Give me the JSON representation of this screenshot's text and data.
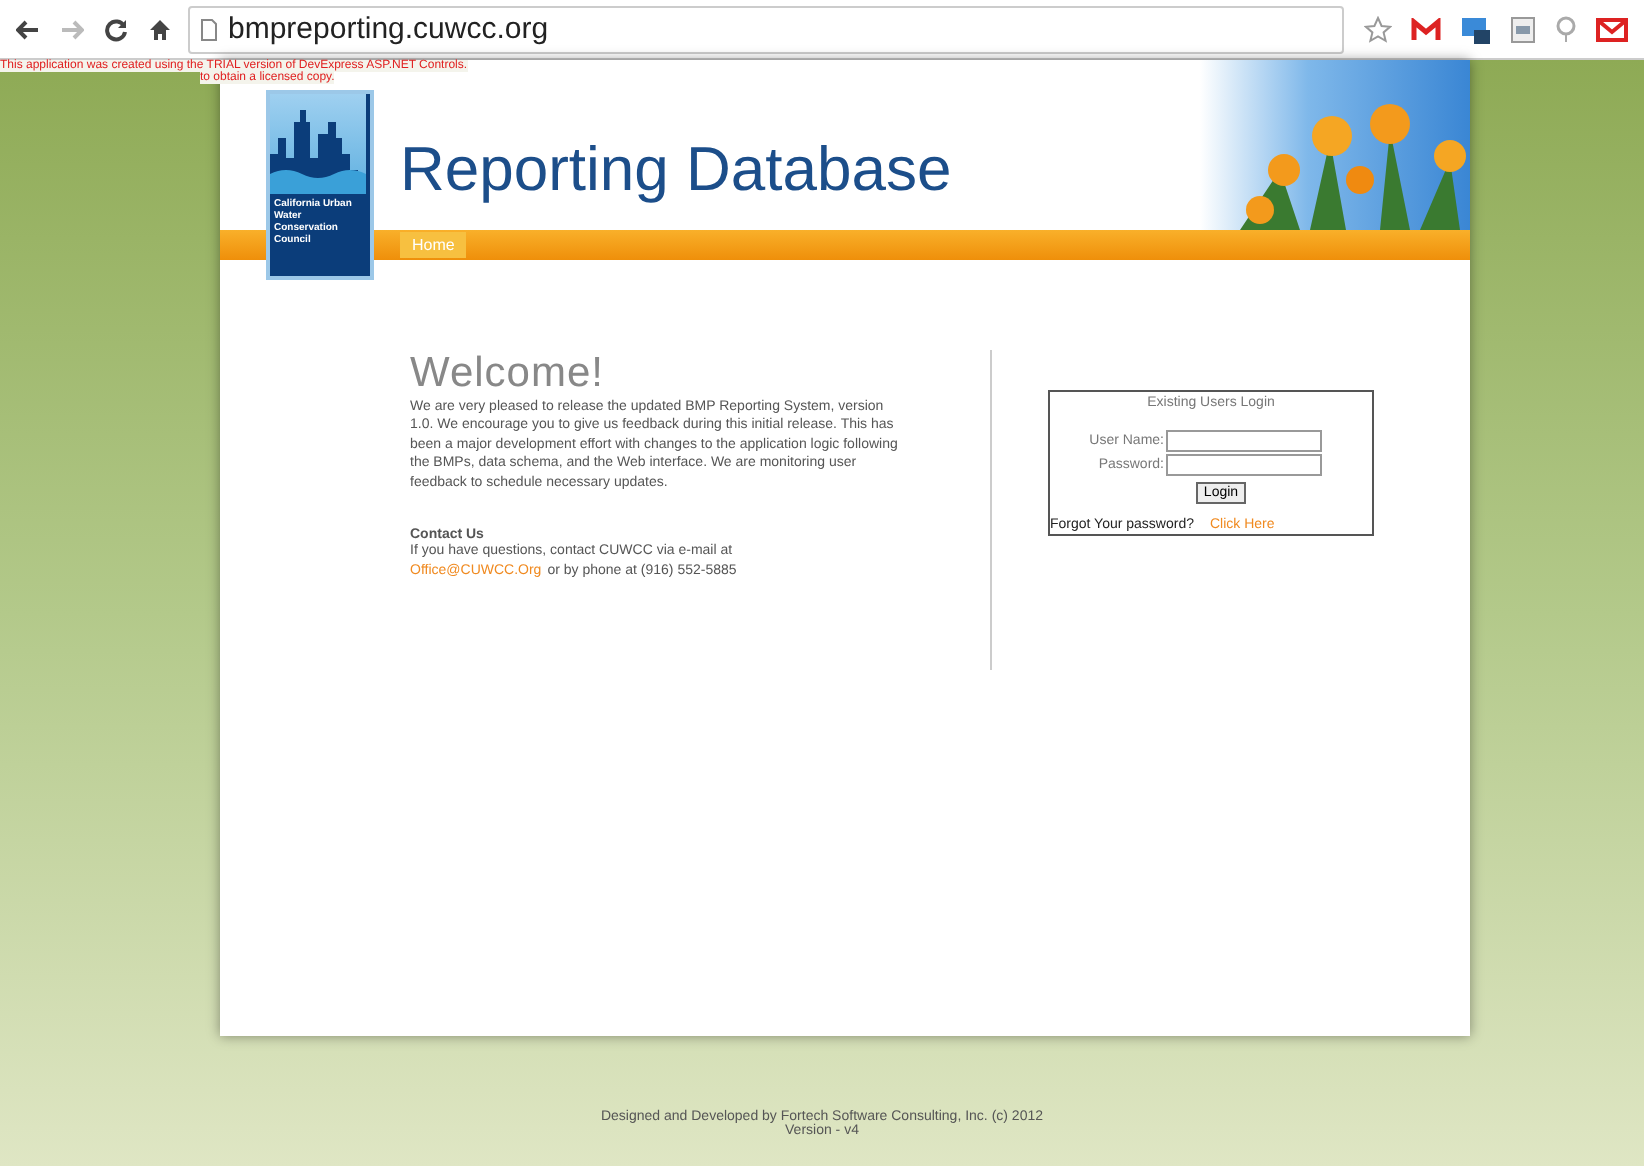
{
  "browser": {
    "url": "bmpreporting.cuwcc.org"
  },
  "trial_notice": {
    "line_1": "This application was created using the TRIAL version of DevExpress ASP.NET Controls.",
    "line_2": "to obtain a licensed copy."
  },
  "header": {
    "logo_text": "California Urban Water Conservation Council",
    "title": "Reporting Database"
  },
  "nav": [
    {
      "label": "Home",
      "selected": true
    }
  ],
  "welcome": {
    "heading": "Welcome!",
    "body": "We are very pleased to release the updated BMP Reporting System, version 1.0. We encourage you to give us feedback during this initial release. This has been a major development effort with changes to the application logic following the BMPs, data schema, and the Web interface. We are monitoring user feedback to schedule necessary updates.",
    "contact_heading": "Contact Us",
    "contact_line": "If you have questions, contact CUWCC via e-mail at",
    "contact_email": "Office@CUWCC.Org",
    "contact_phone": "or by phone at (916) 552-5885"
  },
  "login": {
    "title": "Existing Users Login",
    "username_label": "User Name:",
    "password_label": "Password:",
    "button": "Login",
    "forgot_text": "Forgot Your password?",
    "forgot_link": "Click Here"
  },
  "footer": {
    "credit": "Designed and Developed by Fortech Software Consulting, Inc. (c) 2012",
    "version": "Version - v4"
  }
}
